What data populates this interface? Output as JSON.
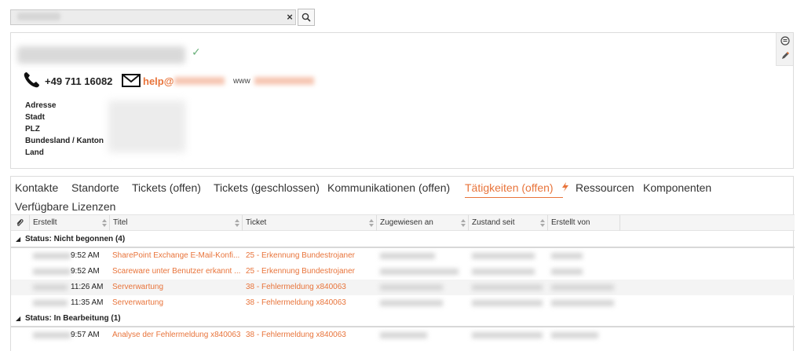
{
  "card": {
    "phone": "+49 711 16082",
    "email": "help@",
    "www_label": "www",
    "address_labels": [
      "Adresse",
      "Stadt",
      "PLZ",
      "Bundesland / Kanton",
      "Land"
    ]
  },
  "tabs": [
    "Kontakte",
    "Standorte",
    "Tickets (offen)",
    "Tickets (geschlossen)",
    "Kommunikationen (offen)",
    "Tätigkeiten (offen)",
    "Ressourcen",
    "Komponenten",
    "Verfügbare Lizenzen"
  ],
  "active_tab": "Tätigkeiten (offen)",
  "grid": {
    "columns": [
      "Erstellt",
      "Titel",
      "Ticket",
      "Zugewiesen an",
      "Zustand seit",
      "Erstellt von"
    ],
    "groups": [
      {
        "label": "Status: Nicht begonnen (4)",
        "rows": [
          {
            "time": "9:52 AM",
            "title": "SharePoint Exchange E-Mail-Konfi...",
            "ticket": "25 - Erkennung Bundestrojaner"
          },
          {
            "time": "9:52 AM",
            "title": "Scareware unter Benutzer erkannt ...",
            "ticket": "25 - Erkennung Bundestrojaner"
          },
          {
            "time": "11:26 AM",
            "title": "Serverwartung",
            "ticket": "38 - Fehlermeldung x840063"
          },
          {
            "time": "11:35 AM",
            "title": "Serverwartung",
            "ticket": "38 - Fehlermeldung x840063"
          }
        ]
      },
      {
        "label": "Status: In Bearbeitung (1)",
        "rows": [
          {
            "time": "9:57 AM",
            "title": "Analyse der Fehlermeldung x840063",
            "ticket": "38 - Fehlermeldung x840063"
          }
        ]
      }
    ]
  },
  "colors": {
    "accent": "#e8743b",
    "check": "#6ab07a"
  }
}
